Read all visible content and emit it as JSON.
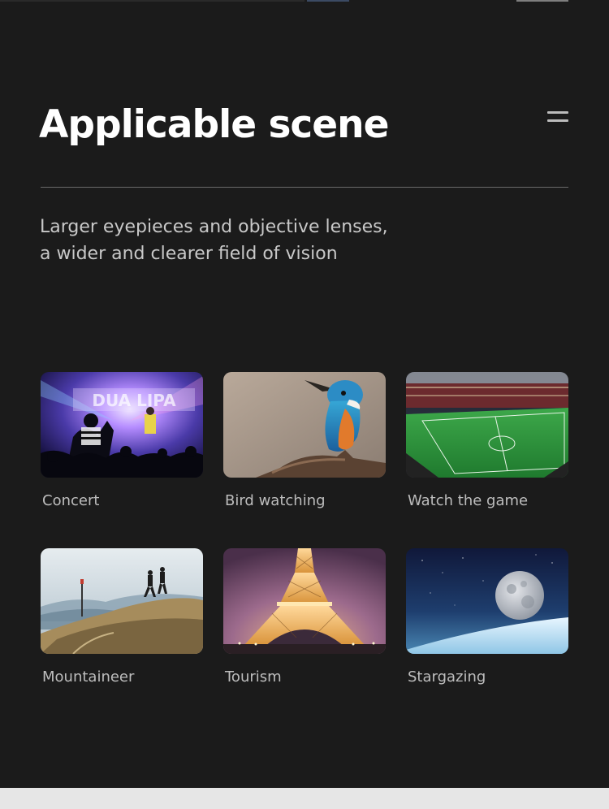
{
  "header": {
    "title": "Applicable scene",
    "menu_icon": "hamburger-menu-icon"
  },
  "intro": {
    "lines": [
      "Larger eyepieces and objective lenses,",
      "a wider and clearer field of vision"
    ]
  },
  "scenes": [
    {
      "label": "Concert",
      "image": "concert-photo"
    },
    {
      "label": "Bird watching",
      "image": "kingfisher-photo"
    },
    {
      "label": "Watch the game",
      "image": "stadium-photo"
    },
    {
      "label": "Mountaineer",
      "image": "hikers-photo"
    },
    {
      "label": "Tourism",
      "image": "eiffel-tower-photo"
    },
    {
      "label": "Stargazing",
      "image": "moon-photo"
    }
  ],
  "colors": {
    "background": "#1b1b1b",
    "title": "#ffffff",
    "text": "#bdbdbd",
    "divider": "#6a6a6a"
  }
}
